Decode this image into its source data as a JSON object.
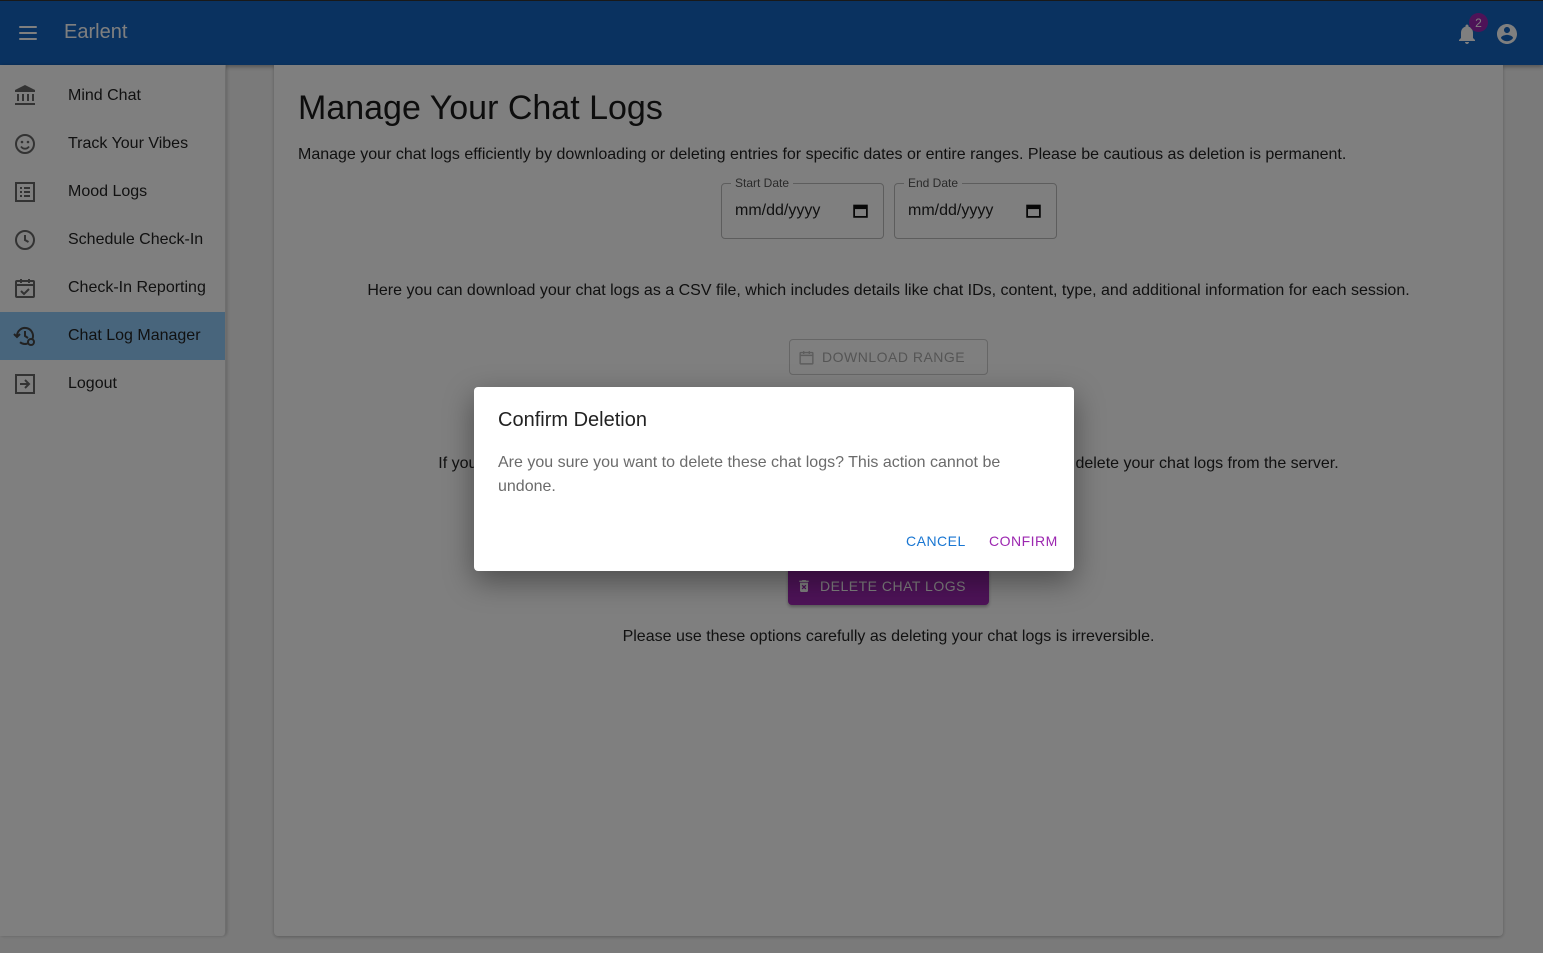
{
  "appbar": {
    "title": "Earlent",
    "notification_count": "2"
  },
  "sidebar": {
    "items": [
      {
        "label": "Mind Chat",
        "icon": "bank-icon"
      },
      {
        "label": "Track Your Vibes",
        "icon": "smiley-icon"
      },
      {
        "label": "Mood Logs",
        "icon": "list-icon"
      },
      {
        "label": "Schedule Check-In",
        "icon": "clock-icon"
      },
      {
        "label": "Check-In Reporting",
        "icon": "calendar-check-icon"
      },
      {
        "label": "Chat Log Manager",
        "icon": "history-gear-icon"
      },
      {
        "label": "Logout",
        "icon": "logout-icon"
      }
    ]
  },
  "main": {
    "title": "Manage Your Chat Logs",
    "description": "Manage your chat logs efficiently by downloading or deleting entries for specific dates or entire ranges. Please be cautious as deletion is permanent.",
    "start_date": {
      "label": "Start Date",
      "value": "mm/dd/yyyy"
    },
    "end_date": {
      "label": "End Date",
      "value": "mm/dd/yyyy"
    },
    "download_description": "Here you can download your chat logs as a CSV file, which includes details like chat IDs, content, type, and additional information for each session.",
    "download_button": "DOWNLOAD RANGE",
    "delete_description_left": "If you",
    "delete_description_right": "delete your chat logs from the server.",
    "delete_button": "DELETE CHAT LOGS",
    "caution": "Please use these options carefully as deleting your chat logs is irreversible."
  },
  "dialog": {
    "title": "Confirm Deletion",
    "text": "Are you sure you want to delete these chat logs? This action cannot be undone.",
    "cancel": "CANCEL",
    "confirm": "CONFIRM"
  },
  "colors": {
    "primary": "#1565c0",
    "accent": "#9c27b0",
    "sidebar_active": "#90caf9"
  }
}
